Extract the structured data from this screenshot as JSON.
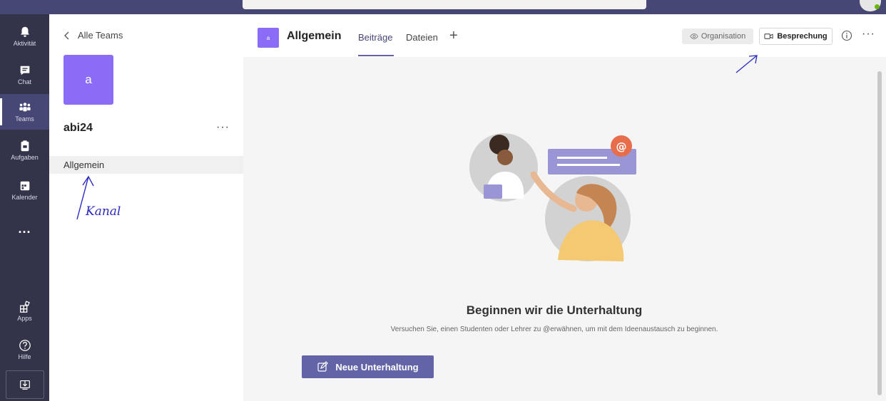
{
  "rail": {
    "items": [
      {
        "label": "Aktivität",
        "icon": "bell-icon"
      },
      {
        "label": "Chat",
        "icon": "chat-icon"
      },
      {
        "label": "Teams",
        "icon": "teams-icon",
        "active": true
      },
      {
        "label": "Aufgaben",
        "icon": "assignments-icon"
      },
      {
        "label": "Kalender",
        "icon": "calendar-icon"
      }
    ],
    "more": "...",
    "bottom": [
      {
        "label": "Apps",
        "icon": "apps-icon"
      },
      {
        "label": "Hilfe",
        "icon": "help-icon"
      }
    ]
  },
  "team": {
    "back_label": "Alle Teams",
    "avatar_letter": "a",
    "name": "abi24",
    "more": "···",
    "channel": "Allgemein",
    "annotation": "Kanal"
  },
  "channel": {
    "avatar_letter": "a",
    "title": "Allgemein",
    "tabs": [
      "Beiträge",
      "Dateien"
    ],
    "add_tab": "+",
    "org_label": "Organisation",
    "meet_label": "Besprechung",
    "more": "···"
  },
  "empty": {
    "title": "Beginnen wir die Unterhaltung",
    "subtitle": "Versuchen Sie, einen Studenten oder Lehrer zu @erwähnen, um mit dem Ideenaustausch zu beginnen.",
    "new_button": "Neue Unterhaltung"
  },
  "colors": {
    "rail_bg": "#33344a",
    "accent": "#6264a7",
    "team_purple": "#8b6cf6"
  }
}
